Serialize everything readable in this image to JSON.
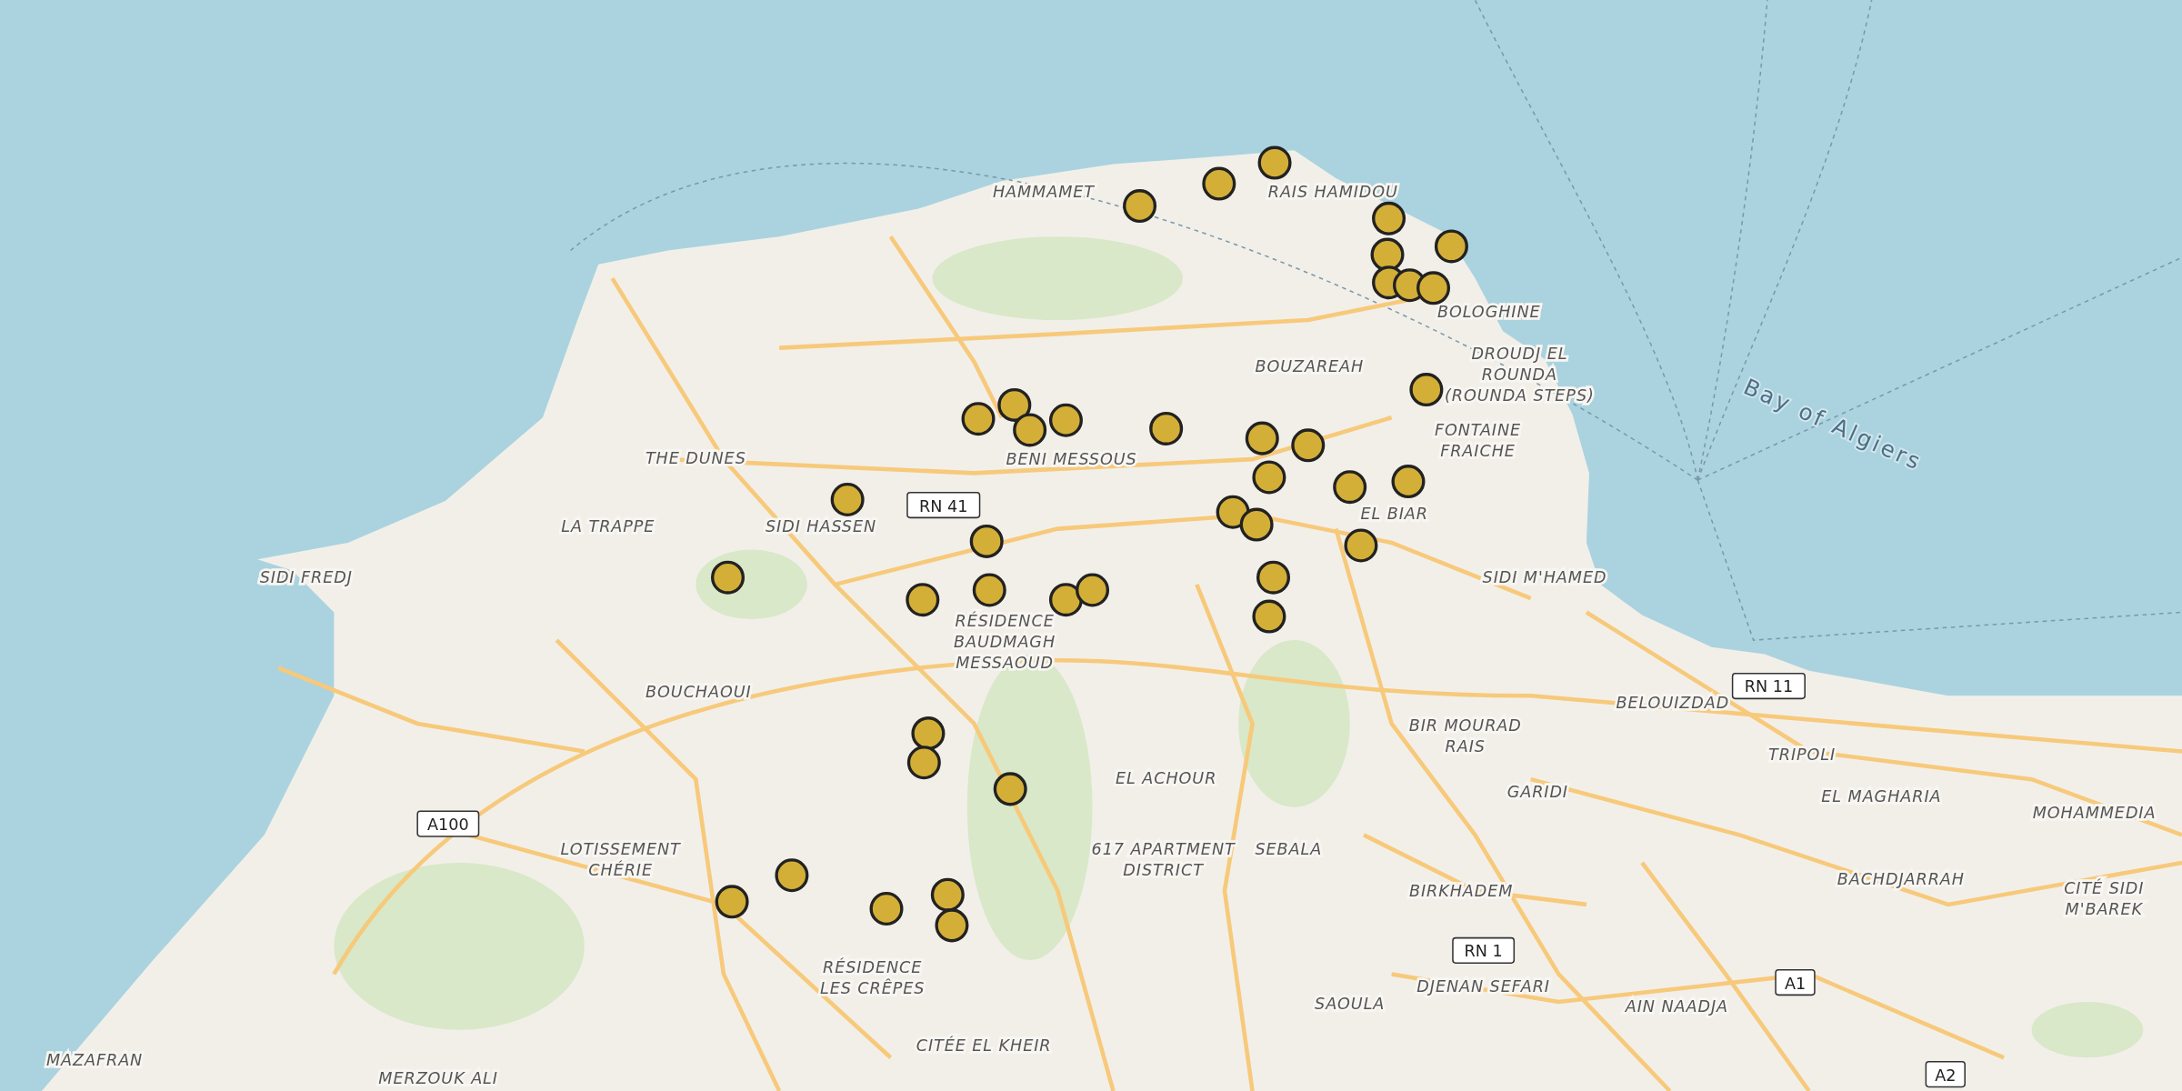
{
  "map": {
    "place_labels": [
      {
        "lines": [
          "HAMMAMET"
        ]
      },
      {
        "lines": [
          "RAIS HAMIDOU"
        ]
      },
      {
        "lines": [
          "BOLOGHINE"
        ]
      },
      {
        "lines": [
          "DROUDJ EL",
          "ROUNDA",
          "(ROUNDA STEPS)"
        ]
      },
      {
        "lines": [
          "BOUZAREAH"
        ]
      },
      {
        "lines": [
          "FONTAINE",
          "FRAICHE"
        ]
      },
      {
        "lines": [
          "THE DUNES"
        ]
      },
      {
        "lines": [
          "BENI MESSOUS"
        ]
      },
      {
        "lines": [
          "LA TRAPPE"
        ]
      },
      {
        "lines": [
          "SIDI HASSEN"
        ]
      },
      {
        "lines": [
          "EL BIAR"
        ]
      },
      {
        "lines": [
          "SIDI FREDJ"
        ]
      },
      {
        "lines": [
          "SIDI M'HAMED"
        ]
      },
      {
        "lines": [
          "RÉSIDENCE",
          "BAUDMAGH",
          "MESSAOUD"
        ]
      },
      {
        "lines": [
          "BOUCHAOUI"
        ]
      },
      {
        "lines": [
          "BELOUIZDAD"
        ]
      },
      {
        "lines": [
          "BIR MOURAD",
          "RAIS"
        ]
      },
      {
        "lines": [
          "TRIPOLI"
        ]
      },
      {
        "lines": [
          "EL ACHOUR"
        ]
      },
      {
        "lines": [
          "GARIDI"
        ]
      },
      {
        "lines": [
          "EL MAGHARIA"
        ]
      },
      {
        "lines": [
          "MOHAMMEDIA"
        ]
      },
      {
        "lines": [
          "LOTISSEMENT",
          "CHÉRIE"
        ]
      },
      {
        "lines": [
          "617 APARTMENT",
          "DISTRICT"
        ]
      },
      {
        "lines": [
          "SEBALA"
        ]
      },
      {
        "lines": [
          "BIRKHADEM"
        ]
      },
      {
        "lines": [
          "BACHDJARRAH"
        ]
      },
      {
        "lines": [
          "CITÉ SIDI",
          "M'BAREK"
        ]
      },
      {
        "lines": [
          "RÉSIDENCE",
          "LES CRÊPES"
        ]
      },
      {
        "lines": [
          "DJENAN SEFARI"
        ]
      },
      {
        "lines": [
          "SAOULA"
        ]
      },
      {
        "lines": [
          "AIN NAADJA"
        ]
      },
      {
        "lines": [
          "CITÉE EL KHEIR"
        ]
      },
      {
        "lines": [
          "MAZAFRAN"
        ]
      },
      {
        "lines": [
          "MERZOUK ALI"
        ]
      }
    ],
    "water_label": "Bay of Algiers",
    "road_shields": [
      "RN 41",
      "RN 11",
      "A100",
      "RN 1",
      "A1",
      "A2"
    ]
  }
}
